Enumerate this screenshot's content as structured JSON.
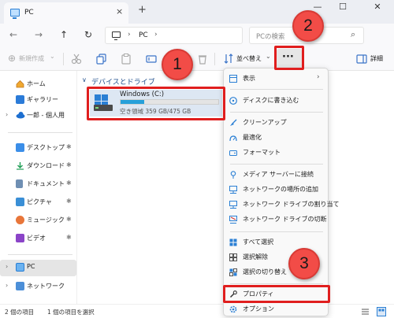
{
  "window": {
    "tab_title": "PC",
    "tab_close": "×",
    "new_tab": "+",
    "minimize": "—",
    "maximize": "☐",
    "close": "✕"
  },
  "address": {
    "back": "←",
    "forward": "→",
    "up": "↑",
    "refresh": "↻",
    "path_sep_1": "›",
    "path": "PC",
    "path_sep_2": "›",
    "search_placeholder": "PCの検索",
    "search_icon": "⌕"
  },
  "toolbar": {
    "new_label": "新規作成",
    "new_icon": "⊕",
    "new_chevron": "⌄",
    "sort_label": "並べ替え",
    "sort_chevron": "⌄",
    "more_label": "···",
    "details_label": "詳細"
  },
  "sidebar": {
    "home": "ホーム",
    "gallery": "ギャラリー",
    "onedrive": "一郎 - 個人用",
    "desktop": "デスクトップ",
    "downloads": "ダウンロード",
    "documents": "ドキュメント",
    "pictures": "ピクチャ",
    "music": "ミュージック",
    "videos": "ビデオ",
    "pc": "PC",
    "network": "ネットワーク",
    "pin": "✱",
    "chevron": "›"
  },
  "content": {
    "group_chevron": "∨",
    "group_title": "デバイスとドライブ",
    "drive_name": "Windows (C:)",
    "drive_space": "空き領域 359 GB/475 GB",
    "drive_used_fraction": 0.245
  },
  "status": {
    "item_count": "2 個の項目",
    "selection": "1 個の項目を選択"
  },
  "menu": {
    "view": "表示",
    "view_arrow": "›",
    "burn": "ディスクに書き込む",
    "cleanup": "クリーンアップ",
    "optimize": "最適化",
    "format": "フォーマット",
    "map_media": "メディア サーバーに接続",
    "add_network_location": "ネットワークの場所の追加",
    "map_drive": "ネットワーク ドライブの割り当て",
    "disconnect_drive": "ネットワーク ドライブの切断",
    "select_all": "すべて選択",
    "select_none": "選択解除",
    "invert_selection": "選択の切り替え",
    "properties": "プロパティ",
    "options": "オプション"
  },
  "annotations": {
    "step1": "1",
    "step2": "2",
    "step3": "3"
  },
  "colors": {
    "accent": "#26a0da",
    "annotation_red": "#e01e1e",
    "badge_fill": "#f24c47"
  }
}
